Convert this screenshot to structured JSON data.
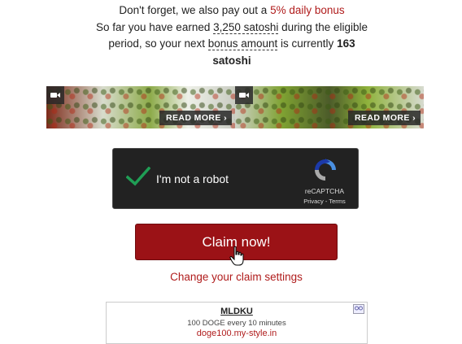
{
  "bonus": {
    "line1_pre": "Don't forget, we also pay out a ",
    "line1_link": "5% daily bonus",
    "line2_pre": "So far you have earned ",
    "line2_amount": "3,250 satoshi",
    "line2_post": " during the eligible period, so your next ",
    "line3_under": "bonus amount",
    "line3_post": " is currently ",
    "next_bonus": "163",
    "unit": "satoshi"
  },
  "promos": [
    {
      "read_more": "READ MORE ›"
    },
    {
      "read_more": "READ MORE ›"
    }
  ],
  "recaptcha": {
    "label": "I'm not a robot",
    "brand": "reCAPTCHA",
    "links": "Privacy - Terms"
  },
  "claim": {
    "button_label": "Claim now!",
    "settings_link": "Change your claim settings"
  },
  "ad": {
    "title": "MLDKU",
    "description": "100 DOGE every 10 minutes",
    "url": "doge100.my-style.in"
  },
  "colors": {
    "accent_red": "#b01c1c",
    "button_bg": "#9b1216",
    "recaptcha_bg": "#222222",
    "check_green": "#1f9e55"
  },
  "icons": [
    "video-icon",
    "checkmark-icon",
    "recaptcha-logo-icon",
    "hand-cursor-icon",
    "ad-choices-icon"
  ]
}
